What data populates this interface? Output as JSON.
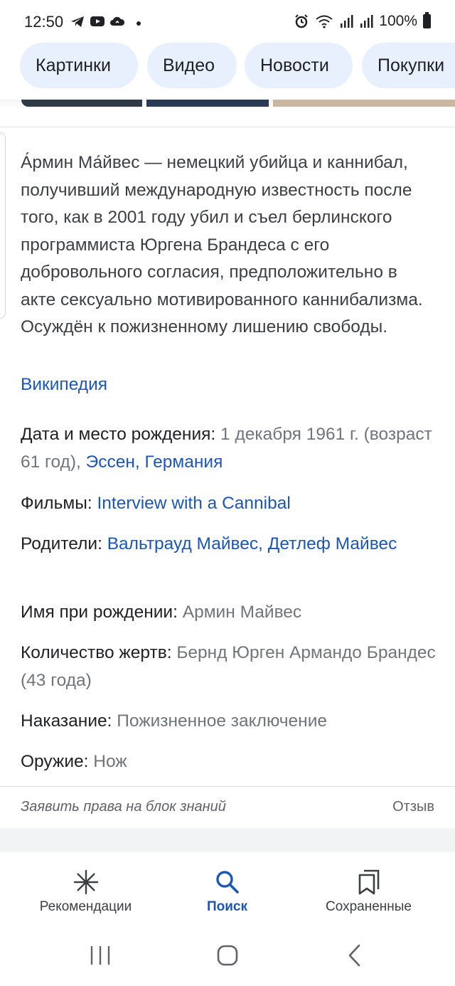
{
  "status_bar": {
    "time": "12:50",
    "left_icons": [
      "telegram-icon",
      "youtube-icon",
      "cloud-icon"
    ],
    "right_icons": [
      "alarm-icon",
      "wifi-icon",
      "signal-icon",
      "signal-icon"
    ],
    "battery": "100%"
  },
  "chips": [
    {
      "label": "Картинки"
    },
    {
      "label": "Видео"
    },
    {
      "label": "Новости"
    },
    {
      "label": "Покупки"
    }
  ],
  "description": {
    "text": "А́рмин Ма́йвес — немецкий убийца и каннибал, получивший международную известность после того, как в 2001 году убил и съел берлинского программиста Юргена Брандеса с его добровольного согласия, предположительно в акте сексуально мотивированного каннибализма. Осуждён к пожизненному лишению свободы.",
    "source_link": "Википедия"
  },
  "facts": {
    "birth": {
      "key": "Дата и место рождения:",
      "value": "1 декабря 1961 г. (возраст 61 год),",
      "link": "Эссен, Германия"
    },
    "films": {
      "key": "Фильмы:",
      "link": "Interview with a Cannibal"
    },
    "parents": {
      "key": "Родители:",
      "link": "Вальтрауд Майвес, Детлеф Майвес"
    },
    "birth_name": {
      "key": "Имя при рождении:",
      "value": "Армин Майвес"
    },
    "victims": {
      "key": "Количество жертв:",
      "value": "Бернд Юрген Армандо Брандес (43 года)"
    },
    "punishment": {
      "key": "Наказание:",
      "value": "Пожизненное заключение"
    },
    "weapon": {
      "key": "Оружие:",
      "value": "Нож"
    }
  },
  "footer": {
    "claim": "Заявить права на блок знаний",
    "feedback": "Отзыв"
  },
  "bottom_nav": [
    {
      "label": "Рекомендации",
      "icon": "asterisk-icon"
    },
    {
      "label": "Поиск",
      "icon": "search-icon",
      "active": true
    },
    {
      "label": "Сохраненные",
      "icon": "bookmarks-icon"
    }
  ],
  "colors": {
    "link": "#1a57b8",
    "chip_bg": "#e8f0fe",
    "muted": "#70757a"
  }
}
